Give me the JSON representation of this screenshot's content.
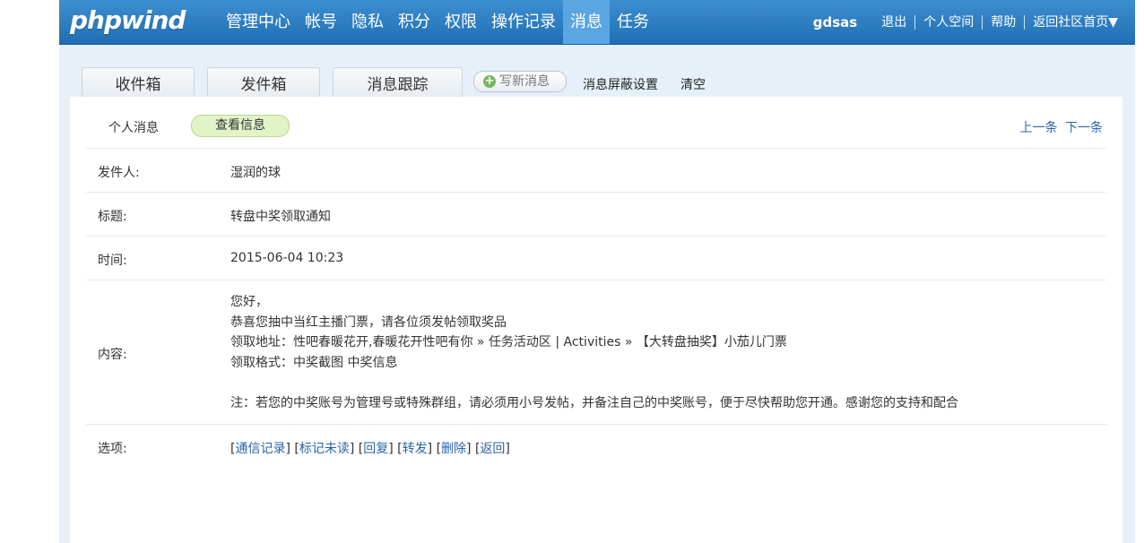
{
  "header": {
    "logo": "phpwind",
    "nav": [
      "管理中心",
      "帐号",
      "隐私",
      "积分",
      "权限",
      "操作记录",
      "消息",
      "任务"
    ],
    "active_nav": "消息",
    "user": "gdsas",
    "user_links": [
      "退出",
      "个人空间",
      "帮助",
      "返回社区首页▼"
    ]
  },
  "tabs": [
    "收件箱",
    "发件箱",
    "消息跟踪"
  ],
  "toolbar": {
    "write_label": "写新消息",
    "block_settings": "消息屏蔽设置",
    "clear": "清空"
  },
  "subtabs": {
    "personal": "个人消息",
    "view": "查看信息"
  },
  "pager": {
    "prev": "上一条",
    "next": "下一条"
  },
  "message": {
    "sender_label": "发件人:",
    "sender": "湿润的球",
    "subject_label": "标题:",
    "subject": "转盘中奖领取通知",
    "time_label": "时间:",
    "time": "2015-06-04 10:23",
    "content_label": "内容:",
    "content_lines": [
      "您好，",
      "恭喜您抽中当红主播门票，请各位须发帖领取奖品",
      "领取地址：性吧春暖花开,春暖花开性吧有你 » 任务活动区 | Activities » 【大转盘抽奖】小茄儿门票",
      "领取格式：中奖截图 中奖信息",
      "",
      "注：若您的中奖账号为管理号或特殊群组，请必须用小号发帖，并备注自己的中奖账号，便于尽快帮助您开通。感谢您的支持和配合"
    ],
    "options_label": "选项:",
    "options": [
      "通信记录",
      "标记未读",
      "回复",
      "转发",
      "删除",
      "返回"
    ]
  },
  "colors": {
    "header_bg": "#2a7cc2",
    "active_nav_bg": "#5aa6e2",
    "link": "#2a64a8",
    "page_bg": "#e7f0f8",
    "subtab_active_bg": "#e2f3c8"
  }
}
